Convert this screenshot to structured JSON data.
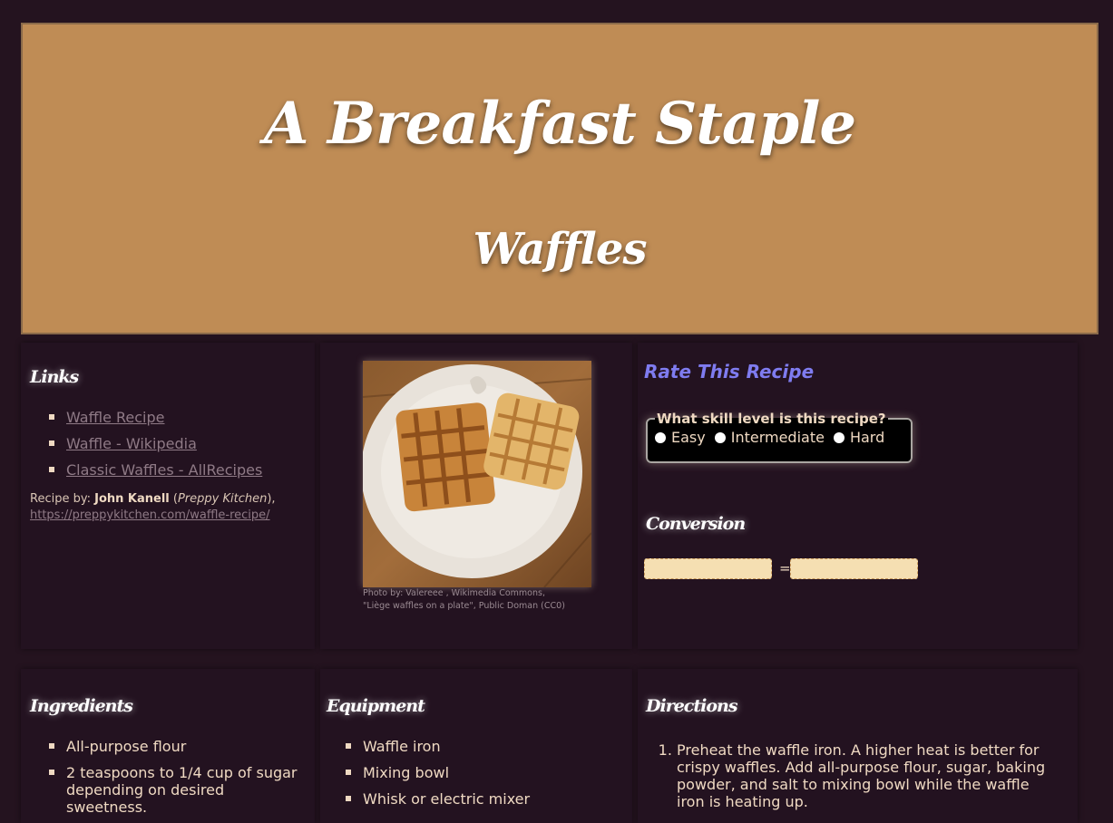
{
  "banner": {
    "title": "A Breakfast Staple",
    "subtitle": "Waffles"
  },
  "links": {
    "heading": "Links",
    "items": [
      {
        "label": "Waffle Recipe"
      },
      {
        "label": "Waffle - Wikipedia"
      },
      {
        "label": "Classic Waffles - AllRecipes"
      }
    ],
    "recipe_by_prefix": "Recipe by:",
    "recipe_author": "John Kanell",
    "recipe_source_open": "(",
    "recipe_source": "Preppy Kitchen",
    "recipe_source_close": "),",
    "recipe_url": "https://preppykitchen.com/waffle-recipe/"
  },
  "photo": {
    "caption": "Photo by: Valereee , Wikimedia Commons, \"Liège waffles on a plate\", Public Doman (CC0)"
  },
  "rating": {
    "heading": "Rate This Recipe",
    "legend": "What skill level is this recipe?",
    "options": [
      "Easy",
      "Intermediate",
      "Hard"
    ]
  },
  "conversion": {
    "heading": "Conversion",
    "equals": "="
  },
  "ingredients": {
    "heading": "Ingredients",
    "items": [
      "All-purpose flour",
      "2 teaspoons to 1/4 cup of sugar depending on desired sweetness."
    ]
  },
  "equipment": {
    "heading": "Equipment",
    "items": [
      "Waffle iron",
      "Mixing bowl",
      "Whisk or electric mixer"
    ]
  },
  "directions": {
    "heading": "Directions",
    "steps": [
      "Preheat the waffle iron. A higher heat is better for crispy waffles. Add all-purpose flour, sugar, baking powder, and salt to mixing bowl while the waffle iron is heating up."
    ]
  }
}
